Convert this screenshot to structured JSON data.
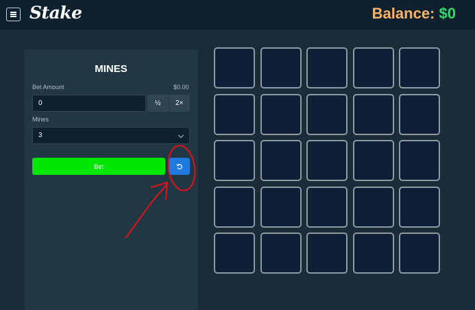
{
  "header": {
    "brand": "Stake",
    "balance_label": "Balance:",
    "balance_value": "$0",
    "colors": {
      "balance_label": "#f7b36a",
      "balance_value": "#35d66b",
      "topbar": "#0f212e"
    }
  },
  "panel": {
    "title": "MINES",
    "bet_amount_label": "Bet Amount",
    "bet_amount_display": "$0.00",
    "bet_amount_value": "0",
    "half_label": "½",
    "double_label": "2×",
    "mines_label": "Mines",
    "mines_value": "3",
    "bet_button_label": "Bet",
    "reset_icon": "refresh-icon",
    "colors": {
      "bet_button": "#00e701",
      "reset_button": "#1f7ae0",
      "panel": "#213743"
    }
  },
  "grid": {
    "rows": 5,
    "cols": 5,
    "tile_color": "#0f1f37",
    "tile_border": "#8f9aa3"
  },
  "annotation": {
    "type": "hand-drawn circle and arrow",
    "target": "reset-button",
    "color": "#e1131c"
  }
}
